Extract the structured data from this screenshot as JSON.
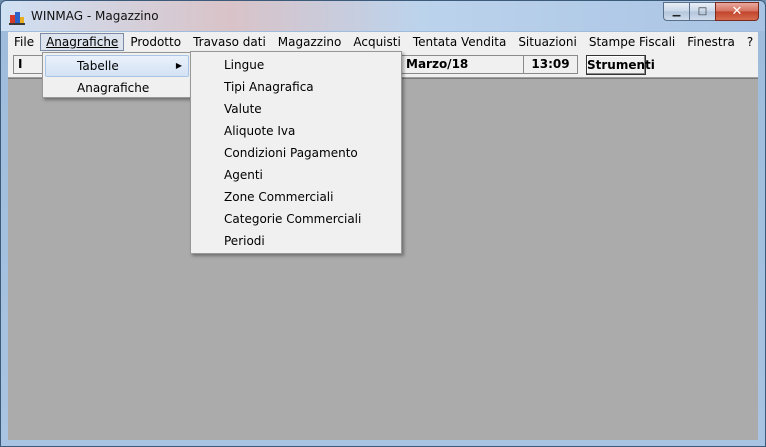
{
  "window": {
    "title": "WINMAG - Magazzino",
    "caption": {
      "minimize": "▁",
      "maximize": "□",
      "close": "✕"
    }
  },
  "menubar": {
    "items": [
      {
        "label": "File",
        "active": false
      },
      {
        "label": "Anagrafiche",
        "active": true
      },
      {
        "label": "Prodotto",
        "active": false
      },
      {
        "label": "Travaso dati",
        "active": false
      },
      {
        "label": "Magazzino",
        "active": false
      },
      {
        "label": "Acquisti",
        "active": false
      },
      {
        "label": "Tentata Vendita",
        "active": false
      },
      {
        "label": "Situazioni",
        "active": false
      },
      {
        "label": "Stampe Fiscali",
        "active": false
      },
      {
        "label": "Finestra",
        "active": false
      },
      {
        "label": "?",
        "active": false
      }
    ]
  },
  "toolbar": {
    "left_field": "I",
    "date": "Marzo/18",
    "time": "13:09",
    "tools_button": "Strumenti"
  },
  "dropdown": {
    "items": [
      {
        "label": "Tabelle",
        "has_submenu": true,
        "highlighted": true
      },
      {
        "label": "Anagrafiche",
        "has_submenu": false,
        "highlighted": false
      }
    ],
    "submenu_arrow": "▶"
  },
  "submenu": {
    "items": [
      "Lingue",
      "Tipi Anagrafica",
      "Valute",
      "Aliquote Iva",
      "Condizioni Pagamento",
      "Agenti",
      "Zone Commerciali",
      "Categorie Commerciali",
      "Periodi"
    ]
  },
  "colors": {
    "client_background": "#ababab",
    "menu_background": "#f0f0f0",
    "highlight": "#d4e2f4"
  }
}
